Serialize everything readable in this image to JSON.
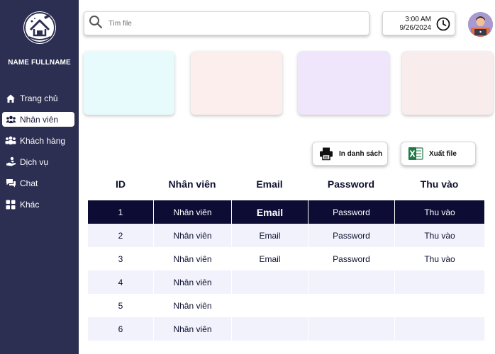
{
  "sidebar": {
    "profile_name": "NAME FULLNAME",
    "items": [
      {
        "label": "Trang chủ",
        "icon": "home-icon",
        "active": false
      },
      {
        "label": "Nhân viên",
        "icon": "users-icon",
        "active": true
      },
      {
        "label": "Khách hàng",
        "icon": "customers-icon",
        "active": false
      },
      {
        "label": "Dịch vụ",
        "icon": "service-icon",
        "active": false
      },
      {
        "label": "Chat",
        "icon": "chat-icon",
        "active": false
      },
      {
        "label": "Khác",
        "icon": "grid-icon",
        "active": false
      }
    ]
  },
  "header": {
    "search_placeholder": "Tìm file",
    "time": "3:00 AM",
    "date": "9/26/2024"
  },
  "cards": [
    {
      "color": "#e8fbfc"
    },
    {
      "color": "#fdeeee"
    },
    {
      "color": "#f0e6fc"
    },
    {
      "color": "#f9ecec"
    }
  ],
  "actions": {
    "print_label": "In danh sách",
    "export_label": "Xuất file"
  },
  "table": {
    "headers": [
      "ID",
      "Nhân viên",
      "Email",
      "Password",
      "Thu vào"
    ],
    "rows": [
      {
        "id": "1",
        "employee": "Nhân viên",
        "email": "Email",
        "password": "Password",
        "income": "Thu vào"
      },
      {
        "id": "2",
        "employee": "Nhân viên",
        "email": "Email",
        "password": "Password",
        "income": "Thu vào"
      },
      {
        "id": "3",
        "employee": "Nhân viên",
        "email": "Email",
        "password": "Password",
        "income": "Thu vào"
      },
      {
        "id": "4",
        "employee": "Nhân viên",
        "email": "",
        "password": "",
        "income": ""
      },
      {
        "id": "5",
        "employee": "Nhân viên",
        "email": "",
        "password": "",
        "income": ""
      },
      {
        "id": "6",
        "employee": "Nhân viên",
        "email": "",
        "password": "",
        "income": ""
      }
    ]
  },
  "colors": {
    "sidebar_bg": "#2d2f52",
    "selected_row": "#0d0c35",
    "alt_row": "#f1f2fb"
  }
}
